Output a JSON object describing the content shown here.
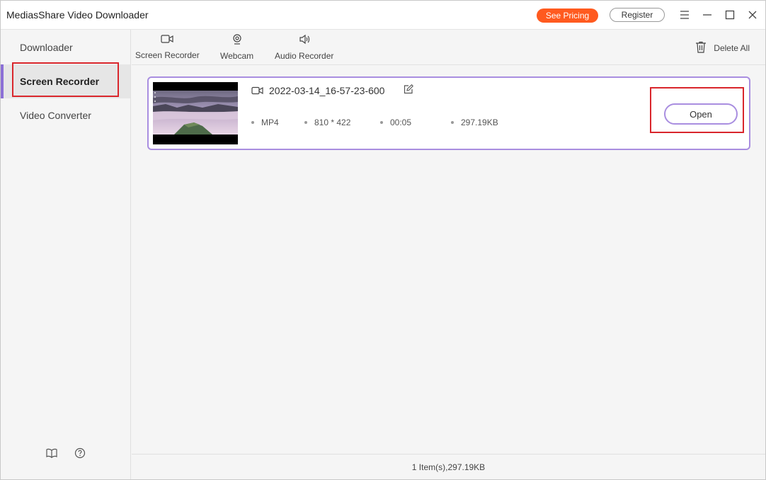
{
  "app": {
    "title": "MediasShare Video Downloader",
    "see_pricing": "See Pricing",
    "register": "Register"
  },
  "colors": {
    "pricing_accent": "#ff5a1f",
    "active_bar": "#8b6fd6",
    "card_border": "#a98ee0",
    "highlight_red": "#d9262c"
  },
  "window_controls": [
    "menu-icon",
    "minimize-icon",
    "maximize-icon",
    "close-icon"
  ],
  "sidebar": {
    "items": [
      {
        "label": "Downloader",
        "active": false
      },
      {
        "label": "Screen Recorder",
        "active": true
      },
      {
        "label": "Video Converter",
        "active": false
      }
    ],
    "footer_icons": [
      "book-icon",
      "help-icon"
    ]
  },
  "toolbar": {
    "tools": [
      {
        "label": "Screen Recorder",
        "icon": "video-camera-icon"
      },
      {
        "label": "Webcam",
        "icon": "webcam-icon"
      },
      {
        "label": "Audio Recorder",
        "icon": "speaker-icon"
      }
    ],
    "delete_all": "Delete All"
  },
  "recording": {
    "name": "2022-03-14_16-57-23-600",
    "format": "MP4",
    "resolution": "810 * 422",
    "duration": "00:05",
    "size": "297.19KB",
    "open_label": "Open"
  },
  "status": {
    "summary": "1 Item(s),297.19KB"
  }
}
